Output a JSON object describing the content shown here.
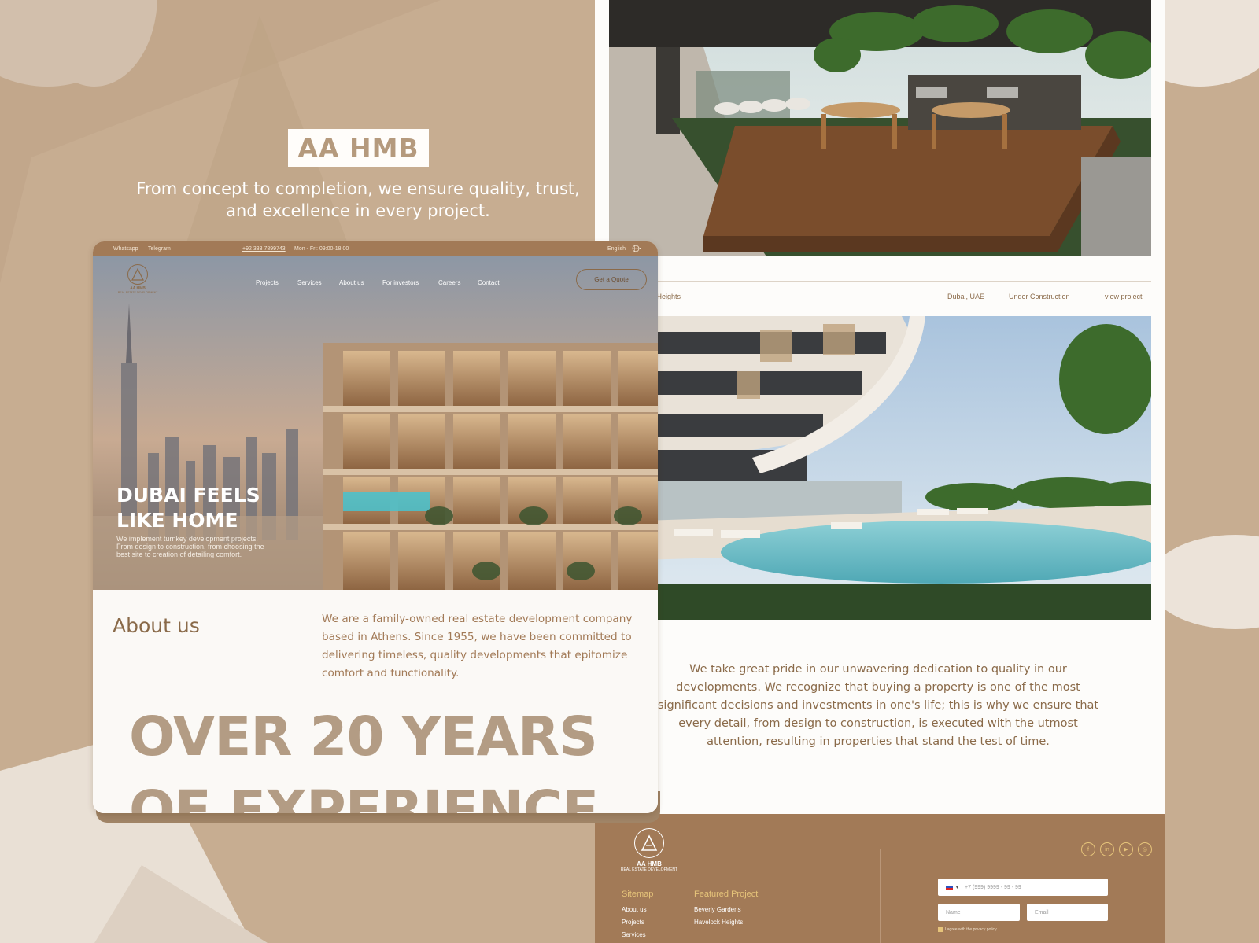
{
  "brand": "AA HMB",
  "tagline": "From concept to completion, we ensure quality, trust, and excellence in every project.",
  "colors": {
    "background": "#c7ad91",
    "accent_brown": "#a27a57",
    "gold": "#e6c47a",
    "text_brown": "#8a6a49",
    "page_white": "#fdfcfa"
  },
  "site": {
    "topbar": {
      "whatsapp": "Whatsapp",
      "telegram": "Telegram",
      "phone": "+92 333 7899743",
      "hours": "Mon - Fri: 09:00-18:00",
      "language": "English",
      "globe_icon": "globe-icon"
    },
    "logo": {
      "name": "AA HMB",
      "subtitle": "REAL ESTATE DEVELOPMENT"
    },
    "nav": [
      "Projects",
      "Services",
      "About us",
      "For investors",
      "Careers",
      "Contact"
    ],
    "cta": "Get a Quote",
    "hero": {
      "title_line1": "DUBAI FEELS",
      "title_line2": "LIKE HOME",
      "subtitle": "We implement turnkey development projects. From design to construction, from choosing the best site to creation of detailing comfort."
    },
    "about": {
      "title": "About us",
      "text": "We are a family-owned real estate development company based in Athens. Since 1955, we have been committed to delivering timeless, quality developments that epitomize comfort and functionality."
    },
    "years_line1": "OVER 20 YEARS",
    "years_line2": "OF EXPERIENCE"
  },
  "project": {
    "name": "Havelock Heights",
    "visible_name": "lock Heights",
    "location": "Dubai, UAE",
    "status": "Under Construction",
    "link": "view project"
  },
  "quality_text": "We take great pride in our unwavering dedication to quality in our developments. We recognize that buying a property is one of the most significant decisions and investments in one's life; this is why we ensure that every detail, from design to construction, is executed with the utmost attention, resulting in properties that stand the test of time.",
  "footer": {
    "logo_name": "AA HMB",
    "logo_subtitle": "REAL ESTATE DEVELOPMENT",
    "sitemap_title": "Sitemap",
    "sitemap_links": [
      "About us",
      "Projects",
      "Services"
    ],
    "featured_title": "Featured Project",
    "featured_links": [
      "Beverly Gardens",
      "Havelock Heights"
    ],
    "social_icons": [
      "facebook-icon",
      "linkedin-icon",
      "youtube-icon",
      "instagram-icon"
    ],
    "social_glyphs": [
      "f",
      "in",
      "▶",
      "◎"
    ],
    "phone_placeholder": "+7 (999) 9999 - 99 - 99",
    "name_placeholder": "Name",
    "email_placeholder": "Email",
    "consent": "I agree with the privacy policy"
  }
}
